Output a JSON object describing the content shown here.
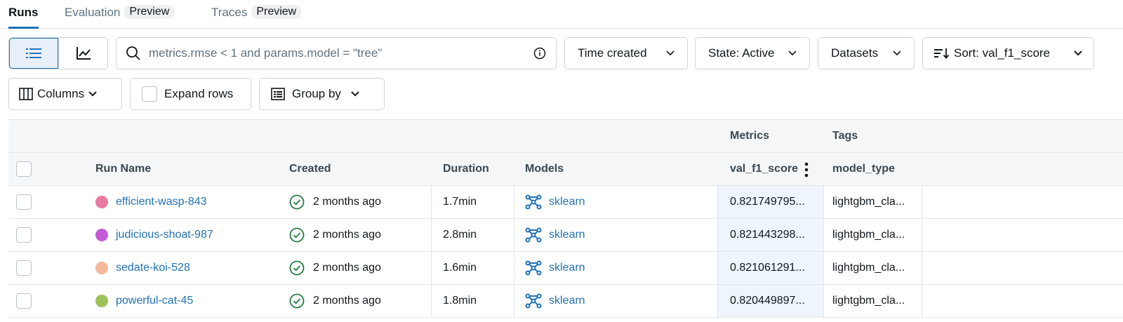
{
  "tabs": [
    {
      "label": "Runs",
      "badge": ""
    },
    {
      "label": "Evaluation",
      "badge": "Preview"
    },
    {
      "label": "Traces",
      "badge": "Preview"
    }
  ],
  "toolbar": {
    "search_placeholder": "metrics.rmse < 1 and params.model = \"tree\"",
    "time_created": "Time created",
    "state": "State: Active",
    "datasets": "Datasets",
    "sort": "Sort: val_f1_score",
    "columns": "Columns",
    "expand_rows": "Expand rows",
    "group_by": "Group by"
  },
  "table": {
    "group_headers": {
      "metrics": "Metrics",
      "tags": "Tags"
    },
    "headers": {
      "run_name": "Run Name",
      "created": "Created",
      "duration": "Duration",
      "models": "Models",
      "metric": "val_f1_score",
      "tag": "model_type"
    },
    "rows": [
      {
        "name": "efficient-wasp-843",
        "color": "#e87aa4",
        "created": "2 months ago",
        "duration": "1.7min",
        "model": "sklearn",
        "metric": "0.821749795...",
        "tag": "lightgbm_cla..."
      },
      {
        "name": "judicious-shoat-987",
        "color": "#c35ad6",
        "created": "2 months ago",
        "duration": "2.8min",
        "model": "sklearn",
        "metric": "0.821443298...",
        "tag": "lightgbm_cla..."
      },
      {
        "name": "sedate-koi-528",
        "color": "#f5b79a",
        "created": "2 months ago",
        "duration": "1.6min",
        "model": "sklearn",
        "metric": "0.821061291...",
        "tag": "lightgbm_cla..."
      },
      {
        "name": "powerful-cat-45",
        "color": "#9cc25a",
        "created": "2 months ago",
        "duration": "1.8min",
        "model": "sklearn",
        "metric": "0.820449897...",
        "tag": "lightgbm_cla..."
      }
    ]
  },
  "colors": {
    "accent": "#2272b4",
    "success": "#277c43"
  }
}
